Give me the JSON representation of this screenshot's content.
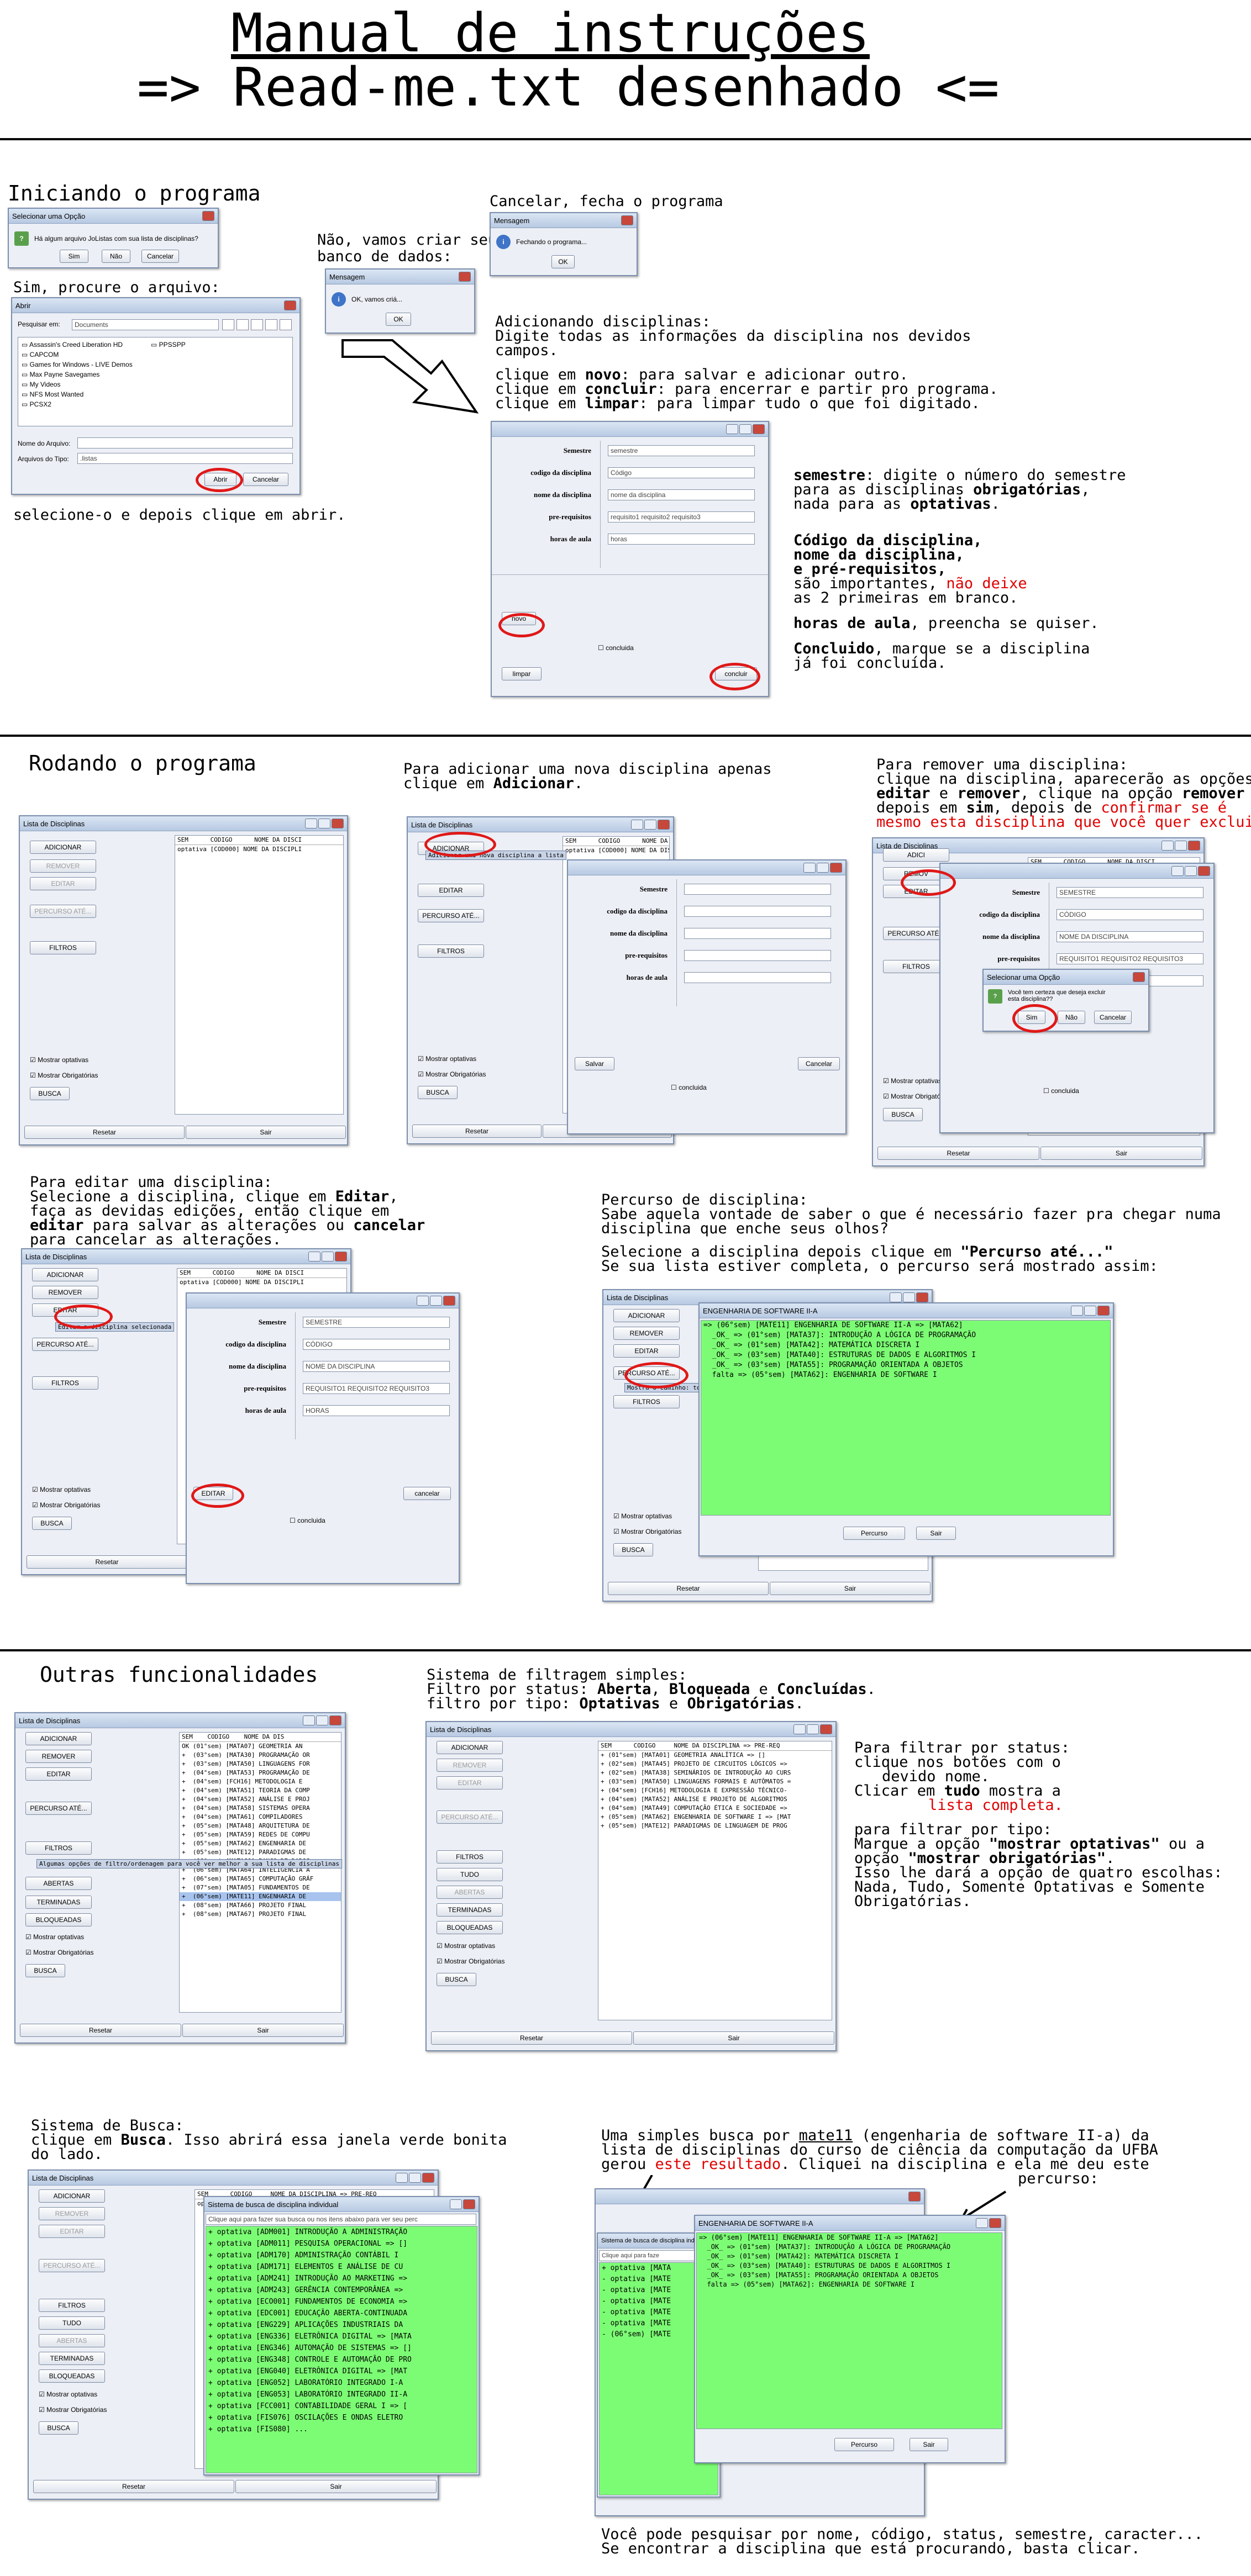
{
  "header": {
    "title_line1": "Manual de instruções",
    "title_line2": "=> Read-me.txt desenhado <="
  },
  "section1": {
    "heading": "Iniciando o programa",
    "dialog_question": {
      "title": "Selecionar uma Opção",
      "message": "Há algum arquivo JoListas com sua lista de disciplinas?",
      "yes": "Sim",
      "no": "Não",
      "cancel": "Cancelar"
    },
    "note_yes": "Sim, procure o arquivo:",
    "open_dialog": {
      "title": "Abrir",
      "look_in_label": "Pesquisar em:",
      "look_in_value": "Documents",
      "files_left": [
        "Assassin's Creed Liberation HD",
        "CAPCOM",
        "Games for Windows - LIVE Demos",
        "Max Payne Savegames",
        "My Videos",
        "NFS Most Wanted",
        "PCSX2"
      ],
      "files_right": [
        "PPSSPP"
      ],
      "filename_label": "Nome do Arquivo:",
      "filetype_label": "Arquivos do Tipo:",
      "filetype_value": ".listas",
      "open": "Abrir",
      "cancel": "Cancelar"
    },
    "note_select": "selecione-o e depois clique em abrir.",
    "note_no": "Não, vamos criar seu\nbanco de dados:",
    "msg_ok": {
      "title": "Mensagem",
      "message": "OK, vamos criá...",
      "ok": "OK"
    },
    "note_cancel": "Cancelar, fecha o programa",
    "msg_close": {
      "title": "Mensagem",
      "message": "Fechando o programa...",
      "ok": "OK"
    },
    "note_add_l1": "Adicionando disciplinas:",
    "note_add_l2": "Digite todas as informações da disciplina nos devidos",
    "note_add_l3": "campos.",
    "note_novo_a": "clique em ",
    "note_novo_b": "novo",
    "note_novo_c": ": para salvar e adicionar outro.",
    "note_concluir_a": "clique em ",
    "note_concluir_b": "concluir",
    "note_concluir_c": ": para encerrar e partir pro programa.",
    "note_limpar_a": "clique em ",
    "note_limpar_b": "limpar",
    "note_limpar_c": ": para limpar tudo o que foi digitado.",
    "form": {
      "labels": [
        "Semestre",
        "codigo da disciplina",
        "nome da disciplina",
        "pre-requisitos",
        "horas de aula"
      ],
      "values": [
        "semestre",
        "Código",
        "nome da disciplina",
        "requisito1 requisito2 requisito3",
        "horas"
      ],
      "novo": "novo",
      "concluida": "concluida",
      "limpar": "limpar",
      "concluir": "concluir"
    },
    "side": {
      "semestre_b": "semestre",
      "semestre_t1": ": digite o número do semestre",
      "semestre_t2": "para as disciplinas ",
      "semestre_t2b": "obrigatórias",
      "semestre_t3": "nada para as ",
      "semestre_t3b": "optativas",
      "codigo_l1": "Código da disciplina,",
      "codigo_l2": "nome da disciplina,",
      "codigo_l3": "e pré-requisitos,",
      "codigo_l4a": "são importantes, ",
      "codigo_l4b": "não deixe",
      "codigo_l5": "as 2 primeiras em branco.",
      "horas_b": "horas de aula",
      "horas_t": ", preencha se quiser.",
      "concluido_b": "Concluido",
      "concluido_t": ", marque se a disciplina",
      "concluido_t2": "já foi concluída."
    }
  },
  "section2": {
    "heading": "Rodando o programa",
    "main_window": {
      "title": "Lista de Disciplinas",
      "buttons": [
        "ADICIONAR",
        "REMOVER",
        "EDITAR",
        "PERCURSO ATÉ...",
        "FILTROS"
      ],
      "show_optional": "Mostrar optativas",
      "show_required": "Mostrar Obrigatórias",
      "search": "BUSCA",
      "reset": "Resetar",
      "exit": "Sair",
      "list_header": "SEM      CODIGO      NOME DA DISCI",
      "list_row": "optativa [COD000] NOME DA DISCIPLI"
    },
    "add_note_l1": "Para adicionar uma nova disciplina apenas",
    "add_note_l2a": "clique em ",
    "add_note_l2b": "Adicionar",
    "add_tip": "Adicionar uma nova disciplina a lista",
    "add_form": {
      "save": "Salvar",
      "cancel": "Cancelar",
      "concluida": "concluida"
    },
    "remove_note_l1": "Para remover uma disciplina:",
    "remove_note_l2": "clique na disciplina, aparecerão as opções",
    "remove_note_l3a": "editar",
    "remove_note_l3b": " e ",
    "remove_note_l3c": "remover",
    "remove_note_l3d": ", clique na opção ",
    "remove_note_l3e": "remover",
    "remove_note_l3f": " e",
    "remove_note_l4a": "depois em ",
    "remove_note_l4b": "sim",
    "remove_note_l4c": ", depois de ",
    "remove_note_l4d": "confirmar se é",
    "remove_note_l5": "mesmo esta disciplina que você quer excluir.",
    "remove_form_values": [
      "SEMESTRE",
      "CÓDIGO",
      "NOME DA DISCIPLINA",
      "REQUISITO1 REQUISITO2 REQUISITO3",
      "HORAS"
    ],
    "confirm": {
      "title": "Selecionar uma Opção",
      "message": "Você tem certeza que deseja excluir esta disciplina??",
      "yes": "Sim",
      "no": "Não",
      "cancel": "Cancelar"
    },
    "remove_btn_short": "REMOV",
    "add_btn_short": "ADICI",
    "edit_note_l1": "Para editar uma disciplina:",
    "edit_note_l2a": "Selecione a disciplina, clique em ",
    "edit_note_l2b": "Editar",
    "edit_note_l3": "faça as devidas edições, então clique em",
    "edit_note_l4a": "editar",
    "edit_note_l4b": " para salvar as alterações ou ",
    "edit_note_l4c": "cancelar",
    "edit_note_l5": "para cancelar as alterações.",
    "edit_tip": "Editar a disciplina selecionada",
    "edit_form": {
      "edit": "EDITAR",
      "cancel": "cancelar",
      "concluida": "concluida"
    },
    "path_note_l1": "Percurso de disciplina:",
    "path_note_l2": "Sabe aquela vontade de saber o que é necessário fazer pra chegar numa",
    "path_note_l3": "disciplina que enche seus olhos?",
    "path_note_l4a": "Selecione a disciplina depois clique em ",
    "path_note_l4b": "\"Percurso até...\"",
    "path_note_l5": "Se sua lista estiver completa, o percurso será mostrado assim:",
    "path_tip": "Mostra o caminho: todas as disciplinas que devem ser feitas para chegar na disciplina selecionada.",
    "path_window": {
      "title": "ENGENHARIA DE SOFTWARE II-A",
      "lines": [
        "=> (06°sem) [MATE11] ENGENHARIA DE SOFTWARE II-A => [MATA62]",
        "  _OK_ => (01°sem) [MATA37]: INTRODUÇÃO A LÓGICA DE PROGRAMAÇÃO",
        "  _OK_ => (01°sem) [MATA42]: MATEMÁTICA DISCRETA I",
        "  _OK_ => (03°sem) [MATA40]: ESTRUTURAS DE DADOS E ALGORITMOS I",
        "  _OK_ => (03°sem) [MATA55]: PROGRAMAÇÃO ORIENTADA A OBJETOS",
        "  falta => (05°sem) [MATA62]: ENGENHARIA DE SOFTWARE I"
      ],
      "percurso": "Percurso",
      "sair": "Sair"
    }
  },
  "section3": {
    "heading": "Outras funcionalidades",
    "list_header": "SEM    CODIGO    NOME DA DIS",
    "list_rows": [
      "OK (01°sem) [MATA07] GEOMETRIA AN",
      "+  (03°sem) [MATA30] PROGRAMAÇÃO OR",
      "+  (03°sem) [MATA50] LINGUAGENS FOR",
      "+  (04°sem) [MATA53] PROGRAMAÇÃO DE",
      "+  (04°sem) [FCH16] METODOLOGIA E",
      "+  (04°sem) [MATA51] TEORIA DA COMP",
      "+  (04°sem) [MATA52] ANÁLISE E PROJ",
      "+  (04°sem) [MATA58] SISTEMAS OPERA",
      "+  (04°sem) [MATA61] COMPILADORES",
      "+  (05°sem) [MATA48] ARQUITETURA DE",
      "+  (05°sem) [MATA59] REDES DE COMPU",
      "+  (05°sem) [MATA62] ENGENHARIA DE",
      "+  (05°sem) [MATE12] PARADIGMAS DE",
      "+  (06°sem) [MATA60] BANCO DE DADOS",
      "+  (06°sem) [MATA64] INTELIGÊNCIA A",
      "+  (06°sem) [MATA65] COMPUTAÇÃO GRÁF",
      "+  (07°sem) [MATA05] FUNDAMENTOS DE",
      "+  (06°sem) [MATE11] ENGENHARIA DE",
      "+  (08°sem) [MATA66] PROJETO FINAL",
      "+  (08°sem) [MATA67] PROJETO FINAL"
    ],
    "filter_tip": "Algumas opções de filtro/ordenagem para você ver melhor a sua lista de disciplinas",
    "filter_buttons": [
      "ABERTAS",
      "TERMINADAS",
      "BLOQUEADAS"
    ],
    "filter_buttons2": [
      "TUDO",
      "ABERTAS",
      "TERMINADAS",
      "BLOQUEADAS"
    ],
    "note_l1": "Sistema de filtragem simples:",
    "note_l2a": "Filtro por status: ",
    "note_l2b": "Aberta",
    "note_l2c": ", ",
    "note_l2d": "Bloqueada",
    "note_l2e": " e ",
    "note_l2f": "Concluídas",
    "note_l3a": "filtro por tipo: ",
    "note_l3b": "Optativas",
    "note_l3c": " e ",
    "note_l3d": "Obrigatórias",
    "list2_header": "SEM      CODIGO     NOME DA DISCIPLINA => PRE-REQ",
    "list2_rows": [
      "+ (01°sem) [MATA01] GEOMETRIA ANALÍTICA => []",
      "+ (02°sem) [MATA45] PROJETO DE CIRCUITOS LÓGICOS =>",
      "+ (02°sem) [MATA38] SEMINÁRIOS DE INTRODUÇÃO AO CURS",
      "+ (03°sem) [MATA50] LINGUAGENS FORMAIS E AUTÔMATOS =",
      "+ (04°sem) [FCH16] METODOLOGIA E EXPRESSÃO TÉCNICO-",
      "+ (04°sem) [MATA52] ANÁLISE E PROJETO DE ALGORITMOS",
      "+ (04°sem) [MATA49] COMPUTAÇÃO ÉTICA E SOCIEDADE =>",
      "+ (05°sem) [MATA62] ENGENHARIA DE SOFTWARE I => [MAT",
      "+ (05°sem) [MATE12] PARADIGMAS DE LINGUAGEM DE PROG"
    ],
    "right_l1": "Para filtrar por status:",
    "right_l2": "clique nos botões com o",
    "right_l3": "devido nome.",
    "right_l4a": "Clicar em ",
    "right_l4b": "tudo",
    "right_l4c": " mostra a",
    "right_l5": "lista completa.",
    "right_l6": "para filtrar por tipo:",
    "right_l7a": "Marque a opção ",
    "right_l7b": "\"mostrar optativas\"",
    "right_l7c": " ou a",
    "right_l8a": "opção ",
    "right_l8b": "\"mostrar obrigatórias\"",
    "right_l9": "Isso lhe dará a opção de quatro escolhas:",
    "right_l10": "Nada, Tudo, Somente Optativas e Somente",
    "right_l11": "Obrigatórias."
  },
  "section4": {
    "note_l1": "Sistema de Busca:",
    "note_l2a": "clique em ",
    "note_l2b": "Busca",
    "note_l2c": ". Isso abrirá essa janela verde bonita",
    "note_l3": "do lado.",
    "search_window": {
      "title": "Sistema de busca de disciplina individual",
      "prompt": "Clique aqui para fazer sua busca ou nos itens abaixo para ver seu perc",
      "rows": [
        "+ optativa [ADM001] INTRODUÇÃO A ADMINISTRAÇÃO",
        "+ optativa [ADM011] PESQUISA OPERACIONAL => []",
        "+ optativa [ADM170] ADMINISTRAÇÃO CONTÁBIL I",
        "+ optativa [ADM171] ELEMENTOS E ANÁLISE DE CU",
        "+ optativa [ADM241] INTRODUÇÃO AO MARKETING =>",
        "+ optativa [ADM243] GERÊNCIA CONTEMPORÂNEA =>",
        "+ optativa [ECO001] FUNDAMENTOS DE ECONOMIA =>",
        "+ optativa [EDC001] EDUCAÇÃO ABERTA-CONTINUADA",
        "+ optativa [ENG229] APLICAÇÕES INDUSTRIAIS DA",
        "+ optativa [ENG336] ELETRÔNICA DIGITAL => [MATA",
        "+ optativa [ENG346] AUTOMAÇÃO DE SISTEMAS => []",
        "+ optativa [ENG348] CONTROLE E AUTOMAÇÃO DE PRO",
        "+ optativa [ENG040] ELETRÔNICA DIGITAL => [MAT",
        "+ optativa [ENG052] LABORATÓRIO INTEGRADO I-A",
        "+ optativa [ENG053] LABORATÓRIO INTEGRADO II-A",
        "+ optativa [FCC001] CONTABILIDADE GERAL I => [",
        "+ optativa [FIS076] OSCILAÇÕES E ONDAS ELETRO",
        "+ optativa [FIS080] ..."
      ]
    },
    "right_l1a": "Uma simples busca por ",
    "right_l1b": "mate11",
    "right_l1c": " (engenharia de software II-a) da",
    "right_l2": "lista de disciplinas do curso de ciência da computação da UFBA",
    "right_l3a": "gerou ",
    "right_l3b": "este resultado",
    "right_l3c": ". Cliquei na disciplina e ela me deu este",
    "right_l4": "percurso:",
    "mini_prompt": "Clique aqui para faze",
    "mini_rows": [
      "+ optativa [MATA",
      "- optativa [MATE",
      "- optativa [MATE",
      "- optativa [MATE",
      "- optativa [MATE",
      "- optativa [MATE",
      "- (06°sem) [MATE"
    ],
    "bottom_l1": "Você pode pesquisar por nome, código, status, semestre, caracter...",
    "bottom_l2": "Se encontrar a disciplina que está procurando, basta clicar."
  },
  "colors": {
    "accent_red": "#e00000",
    "green": "#7cfc74",
    "window_bg": "#eceff5"
  }
}
